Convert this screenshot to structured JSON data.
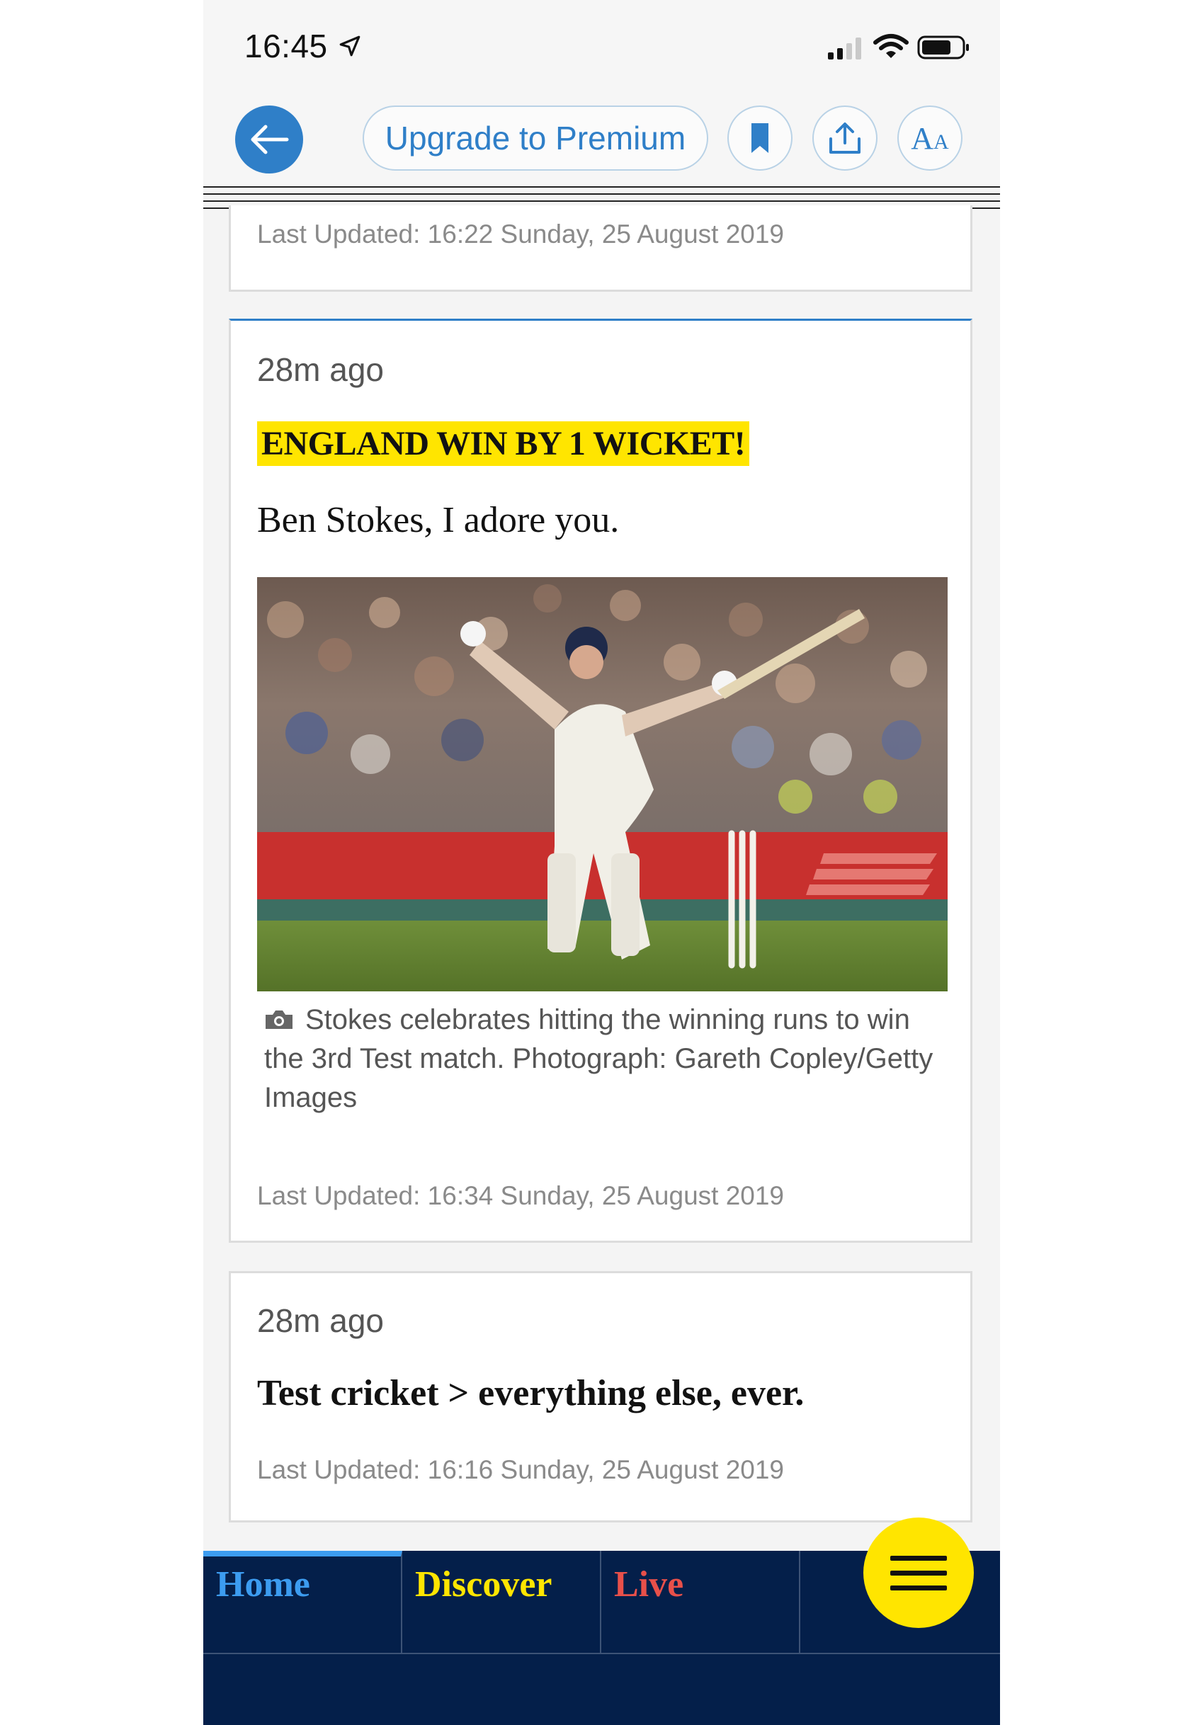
{
  "status_bar": {
    "time": "16:45"
  },
  "toolbar": {
    "premium_label": "Upgrade to Premium",
    "text_size_label_big": "A",
    "text_size_label_small": "A"
  },
  "cards": [
    {
      "updated": "Last Updated: 16:22 Sunday, 25 August 2019"
    },
    {
      "ago": "28m ago",
      "headline": "ENGLAND WIN BY 1 WICKET!",
      "body": "Ben Stokes, I adore you.",
      "caption": "Stokes celebrates hitting the winning runs to win the 3rd Test match. Photograph: Gareth Copley/Getty Images",
      "updated": "Last Updated: 16:34 Sunday, 25 August 2019"
    },
    {
      "ago": "28m ago",
      "body": "Test cricket > everything else, ever.",
      "updated": "Last Updated: 16:16 Sunday, 25 August 2019"
    }
  ],
  "bottom_nav": {
    "tabs": [
      {
        "label": "Home"
      },
      {
        "label": "Discover"
      },
      {
        "label": "Live"
      }
    ]
  },
  "colors": {
    "accent_blue": "#2f7fc8",
    "highlight_yellow": "#ffe500",
    "nav_background": "#041f4a",
    "live_red": "#e8504a"
  },
  "icons": [
    "location-arrow-icon",
    "signal-icon",
    "wifi-icon",
    "battery-icon",
    "back-arrow-icon",
    "bookmark-icon",
    "share-icon",
    "text-size-icon",
    "camera-icon",
    "menu-icon"
  ]
}
